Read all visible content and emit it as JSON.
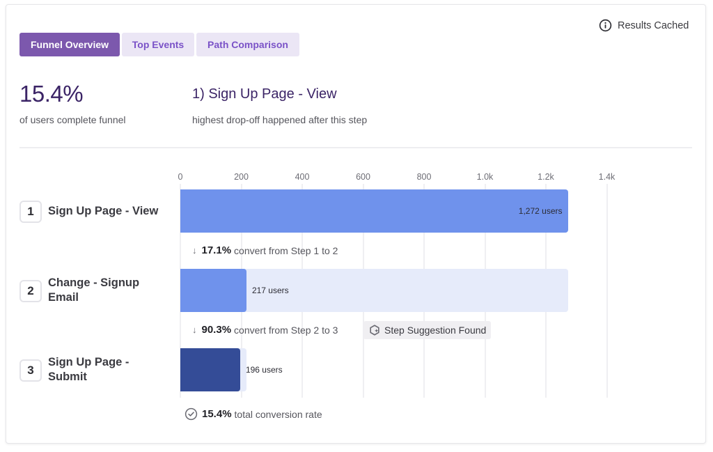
{
  "status": {
    "cached_label": "Results Cached",
    "icon": "info-icon"
  },
  "tabs": [
    {
      "label": "Funnel Overview",
      "active": true
    },
    {
      "label": "Top Events",
      "active": false
    },
    {
      "label": "Path Comparison",
      "active": false
    }
  ],
  "summary": {
    "completion_value": "15.4%",
    "completion_caption": "of users complete funnel",
    "drop_off_step": "1) Sign Up Page - View",
    "drop_off_caption": "highest drop-off happened after this step"
  },
  "colors": {
    "accent": "#7c58ad",
    "bar_primary": "#6f92ec",
    "bar_final": "#344c97",
    "bar_track": "#e6ebfa"
  },
  "chart_data": {
    "type": "bar",
    "orientation": "horizontal",
    "title": "Funnel Overview",
    "xlabel": "",
    "ylabel": "",
    "xlim": [
      0,
      1400
    ],
    "x_ticks": [
      0,
      200,
      400,
      600,
      800,
      1000,
      1200,
      1400
    ],
    "x_tick_labels": [
      "0",
      "200",
      "400",
      "600",
      "800",
      "1.0k",
      "1.2k",
      "1.4k"
    ],
    "grid": true,
    "categories": [
      "Sign Up Page - View",
      "Change - Signup Email",
      "Sign Up Page - Submit"
    ],
    "steps": [
      {
        "number": "1",
        "name_lines": [
          "Sign Up Page - View"
        ],
        "users": 1272,
        "label": "1,272 users",
        "track": null
      },
      {
        "number": "2",
        "name_lines": [
          "Change - Signup",
          "Email"
        ],
        "users": 217,
        "label": "217 users",
        "track": 1272
      },
      {
        "number": "3",
        "name_lines": [
          "Sign Up Page -",
          "Submit"
        ],
        "users": 196,
        "label": "196 users",
        "track": 217
      }
    ],
    "values": [
      1272,
      217,
      196
    ],
    "conversions": [
      {
        "percent": "17.1%",
        "text": "convert from Step 1 to 2"
      },
      {
        "percent": "90.3%",
        "text": "convert from Step 2 to 3"
      }
    ],
    "total": {
      "percent": "15.4%",
      "text": "total conversion rate"
    }
  },
  "suggestion": {
    "label": "Step Suggestion Found",
    "icon": "sparkle-icon"
  }
}
